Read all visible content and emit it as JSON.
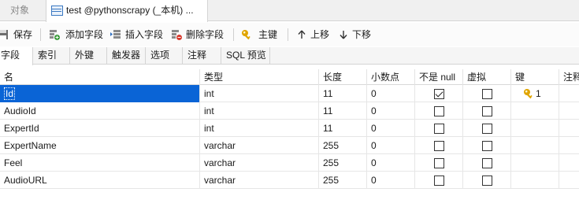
{
  "doc_tabs": {
    "objects_label": "对象",
    "active_label": "test @pythonscrapy (_本机) ..."
  },
  "toolbar": {
    "save_label": "保存",
    "add_field_label": "添加字段",
    "insert_field_label": "插入字段",
    "delete_field_label": "删除字段",
    "primary_key_label": "主键",
    "move_up_label": "上移",
    "move_down_label": "下移"
  },
  "sub_tabs": [
    "字段",
    "索引",
    "外键",
    "触发器",
    "选项",
    "注释",
    "SQL 预览"
  ],
  "columns": [
    "名",
    "类型",
    "长度",
    "小数点",
    "不是 null",
    "虚拟",
    "键",
    "注释"
  ],
  "rows": [
    {
      "name": "Id",
      "type": "int",
      "length": "11",
      "decimals": "0",
      "not_null": true,
      "virtual": false,
      "key": "1"
    },
    {
      "name": "AudioId",
      "type": "int",
      "length": "11",
      "decimals": "0",
      "not_null": false,
      "virtual": false,
      "key": ""
    },
    {
      "name": "ExpertId",
      "type": "int",
      "length": "11",
      "decimals": "0",
      "not_null": false,
      "virtual": false,
      "key": ""
    },
    {
      "name": "ExpertName",
      "type": "varchar",
      "length": "255",
      "decimals": "0",
      "not_null": false,
      "virtual": false,
      "key": ""
    },
    {
      "name": "Feel",
      "type": "varchar",
      "length": "255",
      "decimals": "0",
      "not_null": false,
      "virtual": false,
      "key": ""
    },
    {
      "name": "AudioURL",
      "type": "varchar",
      "length": "255",
      "decimals": "0",
      "not_null": false,
      "virtual": false,
      "key": ""
    }
  ],
  "colors": {
    "selection": "#0a64d6",
    "key_gold": "#e0a400",
    "delete_red": "#d83a2e",
    "add_green": "#3a9b3a"
  }
}
